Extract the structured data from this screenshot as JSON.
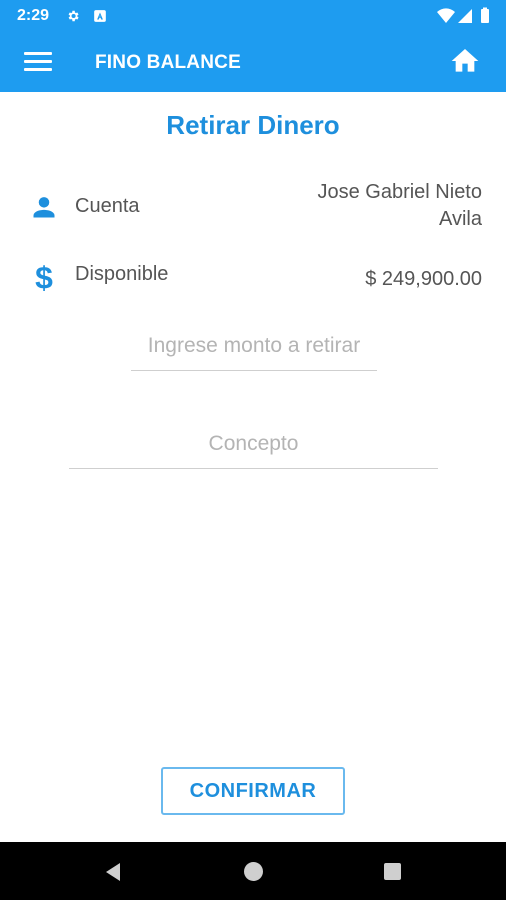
{
  "status_bar": {
    "time": "2:29"
  },
  "app_bar": {
    "title": "FINO BALANCE"
  },
  "main": {
    "title": "Retirar Dinero",
    "account": {
      "label": "Cuenta",
      "value_line1": "Jose Gabriel Nieto",
      "value_line2": "Avila"
    },
    "available": {
      "label": "Disponible",
      "value": "$ 249,900.00"
    },
    "amount_field": {
      "value": "",
      "placeholder": "Ingrese monto a retirar"
    },
    "concept_field": {
      "value": "",
      "placeholder": "Concepto"
    },
    "confirm_label": "CONFIRMAR"
  },
  "colors": {
    "primary": "#1e9cf0",
    "accent_text": "#1e8fdd",
    "nav_bar": "#000000"
  }
}
